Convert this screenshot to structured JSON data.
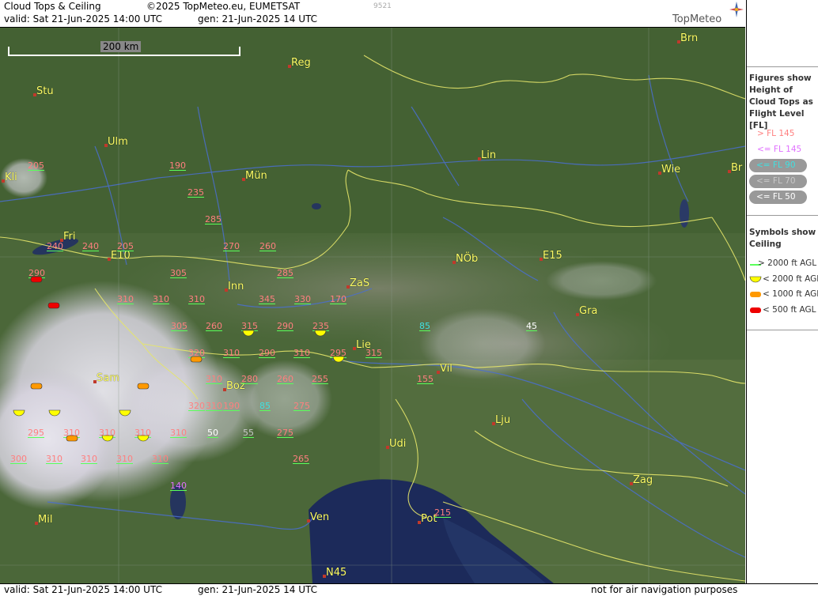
{
  "header": {
    "title": "Cloud Tops & Ceiling",
    "copyright": "©2025 TopMeteo.eu, EUMETSAT",
    "code": "9521",
    "valid": "valid:  Sat  21-Jun-2025  14:00 UTC",
    "gen": "gen: 21-Jun-2025 14 UTC",
    "brand": "TopMeteo"
  },
  "footer": {
    "valid": "valid:  Sat  21-Jun-2025  14:00 UTC",
    "gen": "gen: 21-Jun-2025 14 UTC",
    "disclaimer": "not for air navigation purposes"
  },
  "scale_label": "200 km",
  "colors": {
    "fl_above_145": "#ff7f7f",
    "fl_le_145": "#e070ff",
    "fl_le_90": "#40e0e0",
    "fl_le_70": "#c8c8c8",
    "fl_le_50": "#ffffff",
    "ceil_lt_2000": "#ffff00",
    "ceil_lt_1000": "#ff9900",
    "ceil_lt_500": "#ee0000",
    "city": "#ffff66",
    "ground": "#4e6a3c"
  },
  "legend": {
    "fl_title": "Figures show Height of Cloud Tops as Flight Level  [FL]",
    "fl_items": [
      "> FL 145",
      "<= FL 145",
      "<= FL 90",
      "<= FL 70",
      "<= FL 50"
    ],
    "ceil_title": "Symbols show Ceiling",
    "ceil_items": [
      "> 2000 ft AGL",
      "< 2000 ft AGL",
      "< 1000 ft AGL",
      "< 500 ft AGL"
    ]
  },
  "cities": [
    "Brn",
    "Reg",
    "Stu",
    "Ulm",
    "Mün",
    "Lin",
    "Wie",
    "Br",
    "Kli",
    "Fri",
    "E10",
    "Inn",
    "ZaS",
    "NÖb",
    "E15",
    "Gra",
    "Lie",
    "Vil",
    "Sam",
    "Boz",
    "Lju",
    "Udi",
    "Zag",
    "Mil",
    "Ven",
    "Pot",
    "N45"
  ],
  "map_labels": [
    {
      "v": "205",
      "c": "fl_above_145"
    },
    {
      "v": "190",
      "c": "fl_above_145"
    },
    {
      "v": "235",
      "c": "fl_above_145"
    },
    {
      "v": "285",
      "c": "fl_above_145"
    },
    {
      "v": "240",
      "c": "fl_above_145"
    },
    {
      "v": "240",
      "c": "fl_above_145"
    },
    {
      "v": "205",
      "c": "fl_above_145"
    },
    {
      "v": "270",
      "c": "fl_above_145"
    },
    {
      "v": "260",
      "c": "fl_above_145"
    },
    {
      "v": "290",
      "c": "fl_above_145"
    },
    {
      "v": "305",
      "c": "fl_above_145"
    },
    {
      "v": "285",
      "c": "fl_above_145"
    },
    {
      "v": "310",
      "c": "fl_above_145"
    },
    {
      "v": "310",
      "c": "fl_above_145"
    },
    {
      "v": "310",
      "c": "fl_above_145"
    },
    {
      "v": "345",
      "c": "fl_above_145"
    },
    {
      "v": "330",
      "c": "fl_above_145"
    },
    {
      "v": "170",
      "c": "fl_above_145"
    },
    {
      "v": "305",
      "c": "fl_above_145"
    },
    {
      "v": "260",
      "c": "fl_above_145"
    },
    {
      "v": "315",
      "c": "fl_above_145"
    },
    {
      "v": "290",
      "c": "fl_above_145"
    },
    {
      "v": "235",
      "c": "fl_above_145"
    },
    {
      "v": "85",
      "c": "fl_le_90"
    },
    {
      "v": "45",
      "c": "fl_le_50"
    },
    {
      "v": "320",
      "c": "fl_above_145"
    },
    {
      "v": "310",
      "c": "fl_above_145"
    },
    {
      "v": "290",
      "c": "fl_above_145"
    },
    {
      "v": "310",
      "c": "fl_above_145"
    },
    {
      "v": "295",
      "c": "fl_above_145"
    },
    {
      "v": "315",
      "c": "fl_above_145"
    },
    {
      "v": "310",
      "c": "fl_above_145"
    },
    {
      "v": "280",
      "c": "fl_above_145"
    },
    {
      "v": "260",
      "c": "fl_above_145"
    },
    {
      "v": "255",
      "c": "fl_above_145"
    },
    {
      "v": "155",
      "c": "fl_above_145"
    },
    {
      "v": "310",
      "c": "fl_above_145"
    },
    {
      "v": "320",
      "c": "fl_above_145"
    },
    {
      "v": "190",
      "c": "fl_above_145"
    },
    {
      "v": "85",
      "c": "fl_le_90"
    },
    {
      "v": "275",
      "c": "fl_above_145"
    },
    {
      "v": "310",
      "c": "fl_above_145"
    },
    {
      "v": "50",
      "c": "fl_le_50"
    },
    {
      "v": "55",
      "c": "fl_le_70"
    },
    {
      "v": "275",
      "c": "fl_above_145"
    },
    {
      "v": "295",
      "c": "fl_above_145"
    },
    {
      "v": "310",
      "c": "fl_above_145"
    },
    {
      "v": "300",
      "c": "fl_above_145"
    },
    {
      "v": "310",
      "c": "fl_above_145"
    },
    {
      "v": "310",
      "c": "fl_above_145"
    },
    {
      "v": "310",
      "c": "fl_above_145"
    },
    {
      "v": "310",
      "c": "fl_above_145"
    },
    {
      "v": "265",
      "c": "fl_above_145"
    },
    {
      "v": "140",
      "c": "fl_le_145"
    },
    {
      "v": "215",
      "c": "fl_above_145"
    },
    {
      "v": "310",
      "c": "fl_above_145"
    },
    {
      "v": "310",
      "c": "fl_above_145"
    }
  ],
  "ceiling_symbols": [
    {
      "t": "ceil_lt_500"
    },
    {
      "t": "ceil_lt_500"
    },
    {
      "t": "ceil_lt_2000"
    },
    {
      "t": "ceil_lt_2000"
    },
    {
      "t": "ceil_lt_1000"
    },
    {
      "t": "ceil_lt_2000"
    },
    {
      "t": "ceil_lt_1000"
    },
    {
      "t": "ceil_lt_1000"
    },
    {
      "t": "ceil_lt_2000"
    },
    {
      "t": "ceil_lt_2000"
    },
    {
      "t": "ceil_lt_2000"
    },
    {
      "t": "ceil_lt_1000"
    },
    {
      "t": "ceil_lt_2000"
    },
    {
      "t": "ceil_lt_2000"
    }
  ]
}
